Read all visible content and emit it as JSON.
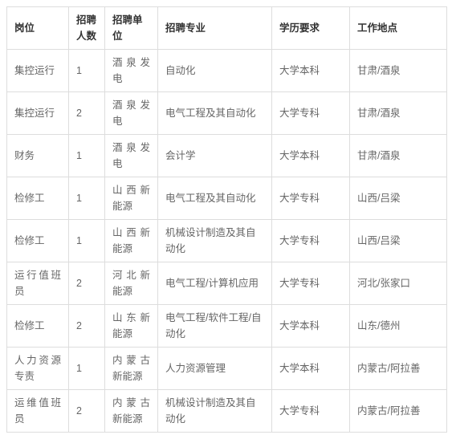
{
  "table": {
    "columns": [
      {
        "key": "post",
        "label": "岗位"
      },
      {
        "key": "count",
        "label": "招聘人数"
      },
      {
        "key": "unit",
        "label": "招聘单位"
      },
      {
        "key": "major",
        "label": "招聘专业"
      },
      {
        "key": "edu",
        "label": "学历要求"
      },
      {
        "key": "location",
        "label": "工作地点"
      }
    ],
    "rows": [
      {
        "post": "集控运行",
        "count": "1",
        "unit": "酒泉发电",
        "major": "自动化",
        "edu": "大学本科",
        "location": "甘肃/酒泉"
      },
      {
        "post": "集控运行",
        "count": "2",
        "unit": "酒泉发电",
        "major": "电气工程及其自动化",
        "edu": "大学专科",
        "location": "甘肃/酒泉"
      },
      {
        "post": "财务",
        "count": "1",
        "unit": "酒泉发电",
        "major": "会计学",
        "edu": "大学本科",
        "location": "甘肃/酒泉"
      },
      {
        "post": "检修工",
        "count": "1",
        "unit": "山西新能源",
        "major": "电气工程及其自动化",
        "edu": "大学专科",
        "location": "山西/吕梁"
      },
      {
        "post": "检修工",
        "count": "1",
        "unit": "山西新能源",
        "major": "机械设计制造及其自动化",
        "edu": "大学专科",
        "location": "山西/吕梁"
      },
      {
        "post": "运行值班员",
        "count": "2",
        "unit": "河北新能源",
        "major": "电气工程/计算机应用",
        "edu": "大学专科",
        "location": "河北/张家口"
      },
      {
        "post": "检修工",
        "count": "2",
        "unit": "山东新能源",
        "major": "电气工程/软件工程/自动化",
        "edu": "大学本科",
        "location": "山东/德州"
      },
      {
        "post": "人力资源专责",
        "count": "1",
        "unit": "内蒙古新能源",
        "major": "人力资源管理",
        "edu": "大学本科",
        "location": "内蒙古/阿拉善"
      },
      {
        "post": "运维值班员",
        "count": "2",
        "unit": "内蒙古新能源",
        "major": "机械设计制造及其自动化",
        "edu": "大学专科",
        "location": "内蒙古/阿拉善"
      }
    ]
  },
  "colors": {
    "border": "#dddddd",
    "header_text": "#333333",
    "body_text": "#666666",
    "background": "#ffffff"
  }
}
